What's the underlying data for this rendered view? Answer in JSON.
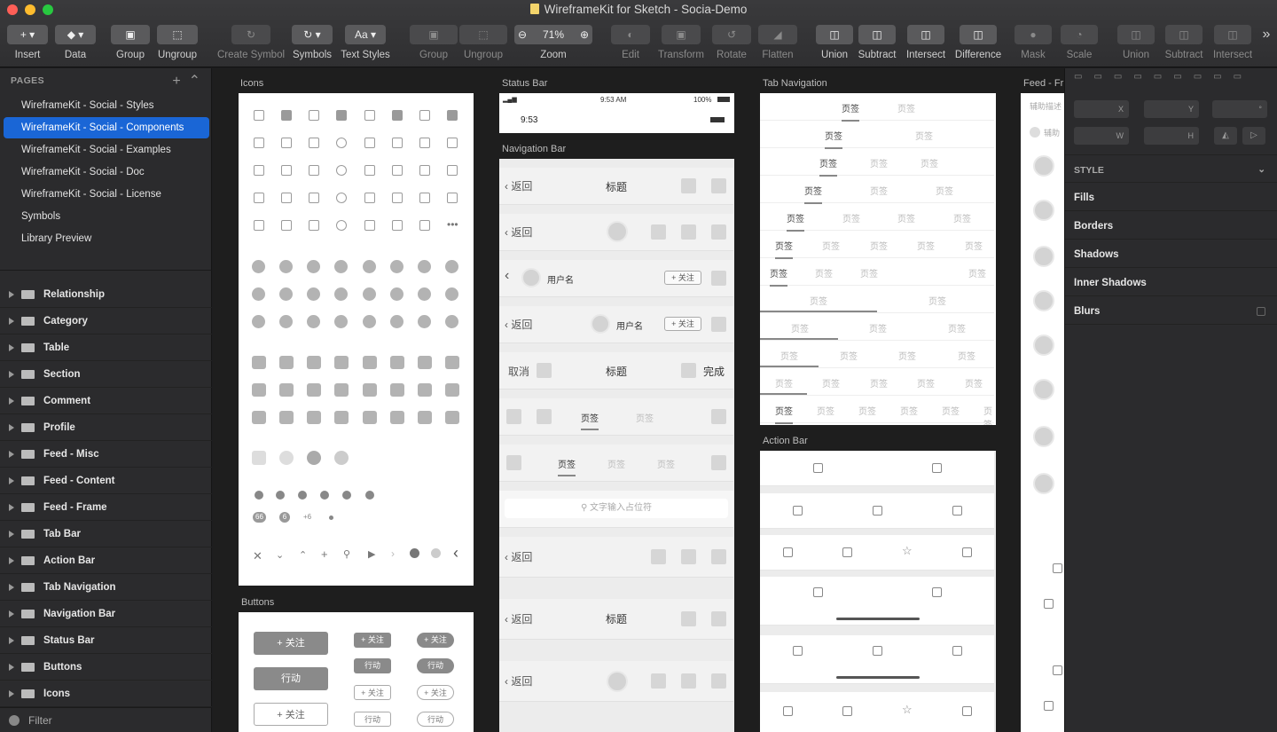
{
  "window": {
    "title": "WireframeKit for Sketch - Socia-Demo",
    "traffic_colors": [
      "#ff5f57",
      "#febc2e",
      "#28c840"
    ]
  },
  "toolbar": {
    "insert": "Insert",
    "data": "Data",
    "group": "Group",
    "ungroup": "Ungroup",
    "create_symbol": "Create Symbol",
    "symbols": "Symbols",
    "text_styles": "Text Styles",
    "text_styles_glyph": "Aa",
    "group2": "Group",
    "ungroup2": "Ungroup",
    "zoom_value": "71%",
    "zoom": "Zoom",
    "edit": "Edit",
    "transform": "Transform",
    "rotate": "Rotate",
    "flatten": "Flatten",
    "union": "Union",
    "subtract": "Subtract",
    "intersect": "Intersect",
    "difference": "Difference",
    "mask": "Mask",
    "scale": "Scale",
    "union2": "Union",
    "subtract2": "Subtract",
    "intersect2": "Intersect",
    "more": "»"
  },
  "sidebar": {
    "pages_header": "PAGES",
    "pages": [
      "WireframeKit - Social - Styles",
      "WireframeKit - Social - Components",
      "WireframeKit - Social - Examples",
      "WireframeKit - Social - Doc",
      "WireframeKit - Social - License",
      "Symbols",
      "Library Preview"
    ],
    "selected_page": 1,
    "layers": [
      "Relationship",
      "Category",
      "Table",
      "Section",
      "Comment",
      "Profile",
      "Feed - Misc",
      "Feed - Content",
      "Feed - Frame",
      "Tab Bar",
      "Action Bar",
      "Tab Navigation",
      "Navigation Bar",
      "Status Bar",
      "Buttons",
      "Icons"
    ],
    "filter": "Filter"
  },
  "canvas": {
    "artboards": {
      "icons": "Icons",
      "buttons": "Buttons",
      "status_bar": "Status Bar",
      "navigation_bar": "Navigation Bar",
      "tab_navigation": "Tab Navigation",
      "action_bar": "Action Bar",
      "feed": "Feed - Fr"
    },
    "icon_badges": [
      "66",
      "6",
      "+6"
    ],
    "status": {
      "time_center": "9:53 AM",
      "battery": "100%",
      "time_left": "9:53"
    },
    "nav": {
      "back": "返回",
      "title": "标题",
      "username": "用户名",
      "follow": "+ 关注",
      "cancel": "取消",
      "done": "完成",
      "tab": "页签",
      "search_placeholder": "文字输入占位符"
    },
    "tabnav_label": "页签",
    "buttons": {
      "follow": "+ 关注",
      "action": "行动"
    },
    "feed": {
      "helper": "辅助描述",
      "helper2": "辅助"
    }
  },
  "inspector": {
    "x": "X",
    "y": "Y",
    "w": "W",
    "h": "H",
    "deg": "°",
    "style": "STYLE",
    "sections": [
      "Fills",
      "Borders",
      "Shadows",
      "Inner Shadows",
      "Blurs"
    ]
  }
}
